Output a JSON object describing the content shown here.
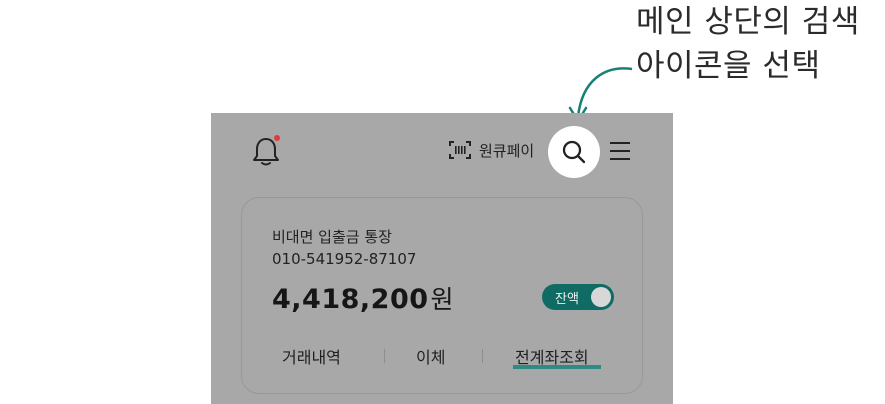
{
  "callout": {
    "line1": "메인 상단의 검색",
    "line2": "아이콘을 선택"
  },
  "header": {
    "wonpay_label": "원큐페이"
  },
  "account": {
    "name": "비대면 입출금 통장",
    "number": "010-541952-87107",
    "balance": "4,418,200",
    "balance_unit": "원",
    "toggle_label": "잔액"
  },
  "actions": {
    "history": "거래내역",
    "transfer": "이체",
    "all_accounts": "전계좌조회"
  },
  "colors": {
    "accent": "#0f6b63",
    "underline": "#2e8a82",
    "notification_dot": "#e23a3a",
    "overlay": "#a8a8a8"
  },
  "icons": [
    "bell-icon",
    "barcode-scan-icon",
    "search-icon",
    "menu-icon",
    "arrow-icon"
  ]
}
